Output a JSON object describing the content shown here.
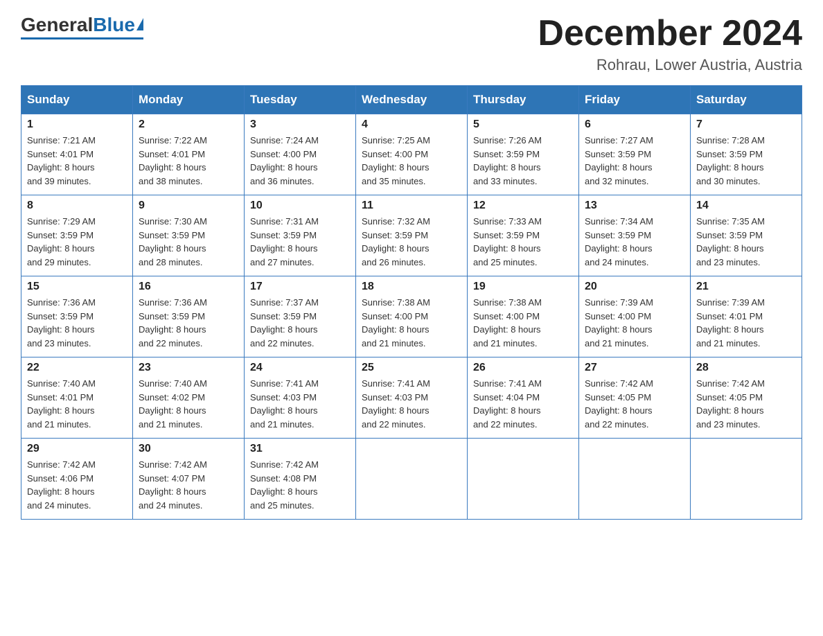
{
  "logo": {
    "general": "General",
    "blue": "Blue"
  },
  "title": {
    "month": "December 2024",
    "location": "Rohrau, Lower Austria, Austria"
  },
  "days_of_week": [
    "Sunday",
    "Monday",
    "Tuesday",
    "Wednesday",
    "Thursday",
    "Friday",
    "Saturday"
  ],
  "weeks": [
    [
      {
        "day": "1",
        "sunrise": "7:21 AM",
        "sunset": "4:01 PM",
        "daylight": "8 hours and 39 minutes."
      },
      {
        "day": "2",
        "sunrise": "7:22 AM",
        "sunset": "4:01 PM",
        "daylight": "8 hours and 38 minutes."
      },
      {
        "day": "3",
        "sunrise": "7:24 AM",
        "sunset": "4:00 PM",
        "daylight": "8 hours and 36 minutes."
      },
      {
        "day": "4",
        "sunrise": "7:25 AM",
        "sunset": "4:00 PM",
        "daylight": "8 hours and 35 minutes."
      },
      {
        "day": "5",
        "sunrise": "7:26 AM",
        "sunset": "3:59 PM",
        "daylight": "8 hours and 33 minutes."
      },
      {
        "day": "6",
        "sunrise": "7:27 AM",
        "sunset": "3:59 PM",
        "daylight": "8 hours and 32 minutes."
      },
      {
        "day": "7",
        "sunrise": "7:28 AM",
        "sunset": "3:59 PM",
        "daylight": "8 hours and 30 minutes."
      }
    ],
    [
      {
        "day": "8",
        "sunrise": "7:29 AM",
        "sunset": "3:59 PM",
        "daylight": "8 hours and 29 minutes."
      },
      {
        "day": "9",
        "sunrise": "7:30 AM",
        "sunset": "3:59 PM",
        "daylight": "8 hours and 28 minutes."
      },
      {
        "day": "10",
        "sunrise": "7:31 AM",
        "sunset": "3:59 PM",
        "daylight": "8 hours and 27 minutes."
      },
      {
        "day": "11",
        "sunrise": "7:32 AM",
        "sunset": "3:59 PM",
        "daylight": "8 hours and 26 minutes."
      },
      {
        "day": "12",
        "sunrise": "7:33 AM",
        "sunset": "3:59 PM",
        "daylight": "8 hours and 25 minutes."
      },
      {
        "day": "13",
        "sunrise": "7:34 AM",
        "sunset": "3:59 PM",
        "daylight": "8 hours and 24 minutes."
      },
      {
        "day": "14",
        "sunrise": "7:35 AM",
        "sunset": "3:59 PM",
        "daylight": "8 hours and 23 minutes."
      }
    ],
    [
      {
        "day": "15",
        "sunrise": "7:36 AM",
        "sunset": "3:59 PM",
        "daylight": "8 hours and 23 minutes."
      },
      {
        "day": "16",
        "sunrise": "7:36 AM",
        "sunset": "3:59 PM",
        "daylight": "8 hours and 22 minutes."
      },
      {
        "day": "17",
        "sunrise": "7:37 AM",
        "sunset": "3:59 PM",
        "daylight": "8 hours and 22 minutes."
      },
      {
        "day": "18",
        "sunrise": "7:38 AM",
        "sunset": "4:00 PM",
        "daylight": "8 hours and 21 minutes."
      },
      {
        "day": "19",
        "sunrise": "7:38 AM",
        "sunset": "4:00 PM",
        "daylight": "8 hours and 21 minutes."
      },
      {
        "day": "20",
        "sunrise": "7:39 AM",
        "sunset": "4:00 PM",
        "daylight": "8 hours and 21 minutes."
      },
      {
        "day": "21",
        "sunrise": "7:39 AM",
        "sunset": "4:01 PM",
        "daylight": "8 hours and 21 minutes."
      }
    ],
    [
      {
        "day": "22",
        "sunrise": "7:40 AM",
        "sunset": "4:01 PM",
        "daylight": "8 hours and 21 minutes."
      },
      {
        "day": "23",
        "sunrise": "7:40 AM",
        "sunset": "4:02 PM",
        "daylight": "8 hours and 21 minutes."
      },
      {
        "day": "24",
        "sunrise": "7:41 AM",
        "sunset": "4:03 PM",
        "daylight": "8 hours and 21 minutes."
      },
      {
        "day": "25",
        "sunrise": "7:41 AM",
        "sunset": "4:03 PM",
        "daylight": "8 hours and 22 minutes."
      },
      {
        "day": "26",
        "sunrise": "7:41 AM",
        "sunset": "4:04 PM",
        "daylight": "8 hours and 22 minutes."
      },
      {
        "day": "27",
        "sunrise": "7:42 AM",
        "sunset": "4:05 PM",
        "daylight": "8 hours and 22 minutes."
      },
      {
        "day": "28",
        "sunrise": "7:42 AM",
        "sunset": "4:05 PM",
        "daylight": "8 hours and 23 minutes."
      }
    ],
    [
      {
        "day": "29",
        "sunrise": "7:42 AM",
        "sunset": "4:06 PM",
        "daylight": "8 hours and 24 minutes."
      },
      {
        "day": "30",
        "sunrise": "7:42 AM",
        "sunset": "4:07 PM",
        "daylight": "8 hours and 24 minutes."
      },
      {
        "day": "31",
        "sunrise": "7:42 AM",
        "sunset": "4:08 PM",
        "daylight": "8 hours and 25 minutes."
      },
      null,
      null,
      null,
      null
    ]
  ],
  "labels": {
    "sunrise": "Sunrise:",
    "sunset": "Sunset:",
    "daylight": "Daylight:"
  }
}
